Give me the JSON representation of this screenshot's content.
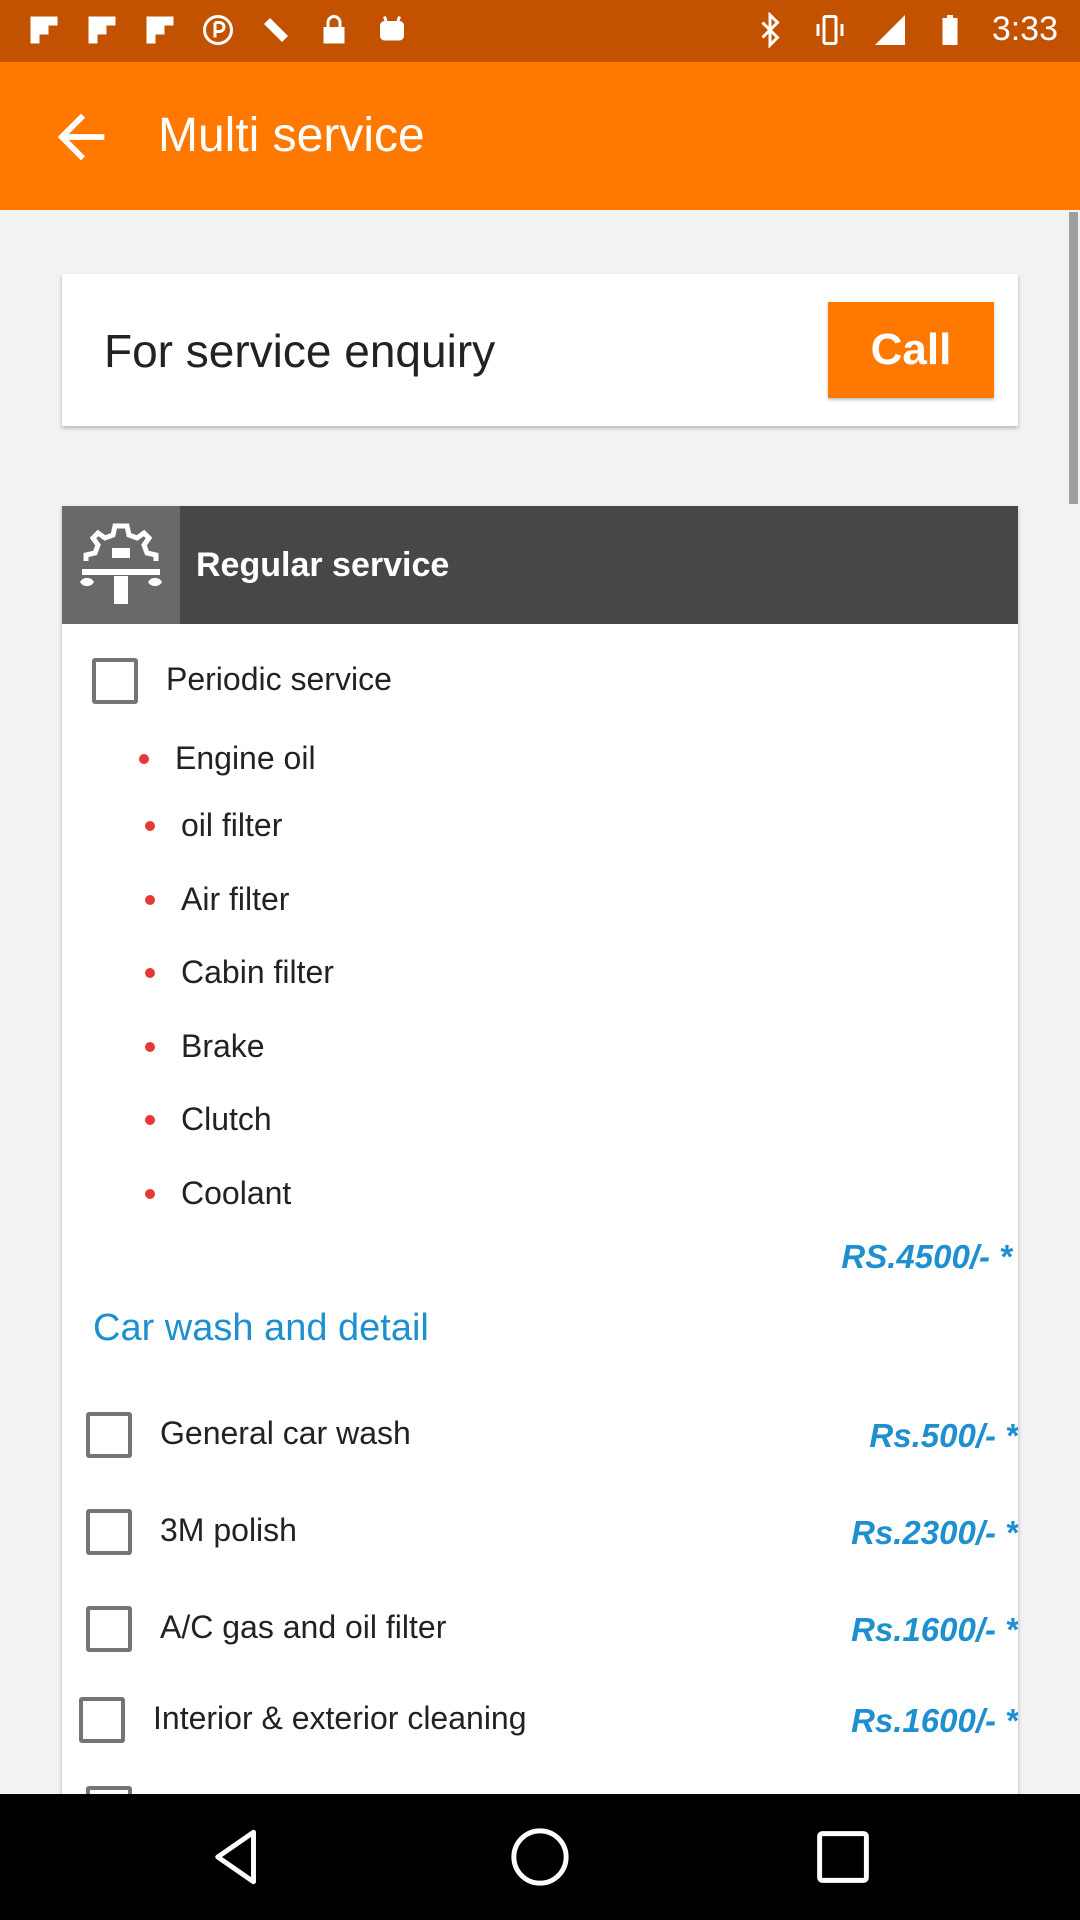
{
  "status_bar": {
    "time": "3:33",
    "icons": [
      "flipboard-icon",
      "flipboard-icon",
      "flipboard-icon",
      "circle-p-icon",
      "fake-gps-icon",
      "lock-icon",
      "android-icon",
      "bluetooth-icon",
      "vibrate-icon",
      "signal-icon",
      "battery-icon"
    ]
  },
  "app_bar": {
    "title": "Multi service",
    "back_icon": "arrow-back-icon"
  },
  "enquiry": {
    "label": "For service enquiry",
    "call_label": "Call"
  },
  "regular_service": {
    "header_title": "Regular service",
    "header_icon": "gear-wrench-icon",
    "periodic": {
      "label": "Periodic service",
      "items": [
        "Engine oil",
        "oil filter",
        "Air filter",
        "Cabin filter",
        "Brake",
        "Clutch",
        "Coolant"
      ],
      "price": "RS.4500/- *"
    }
  },
  "car_wash": {
    "title": "Car wash and detail",
    "options": [
      {
        "label": "General car wash",
        "price": "Rs.500/- *"
      },
      {
        "label": "3M polish",
        "price": "Rs.2300/- *"
      },
      {
        "label": "A/C gas and oil filter",
        "price": "Rs.1600/- *"
      },
      {
        "label": "Interior & exterior cleaning",
        "price": "Rs.1600/- *"
      }
    ]
  },
  "colors": {
    "accent": "#ff7800",
    "status_bar": "#c25100",
    "card_header": "#454749",
    "price": "#1e8fcf",
    "bullet": "#e53935"
  },
  "nav_bar": {
    "icons": [
      "nav-back-icon",
      "nav-home-icon",
      "nav-recents-icon"
    ]
  }
}
